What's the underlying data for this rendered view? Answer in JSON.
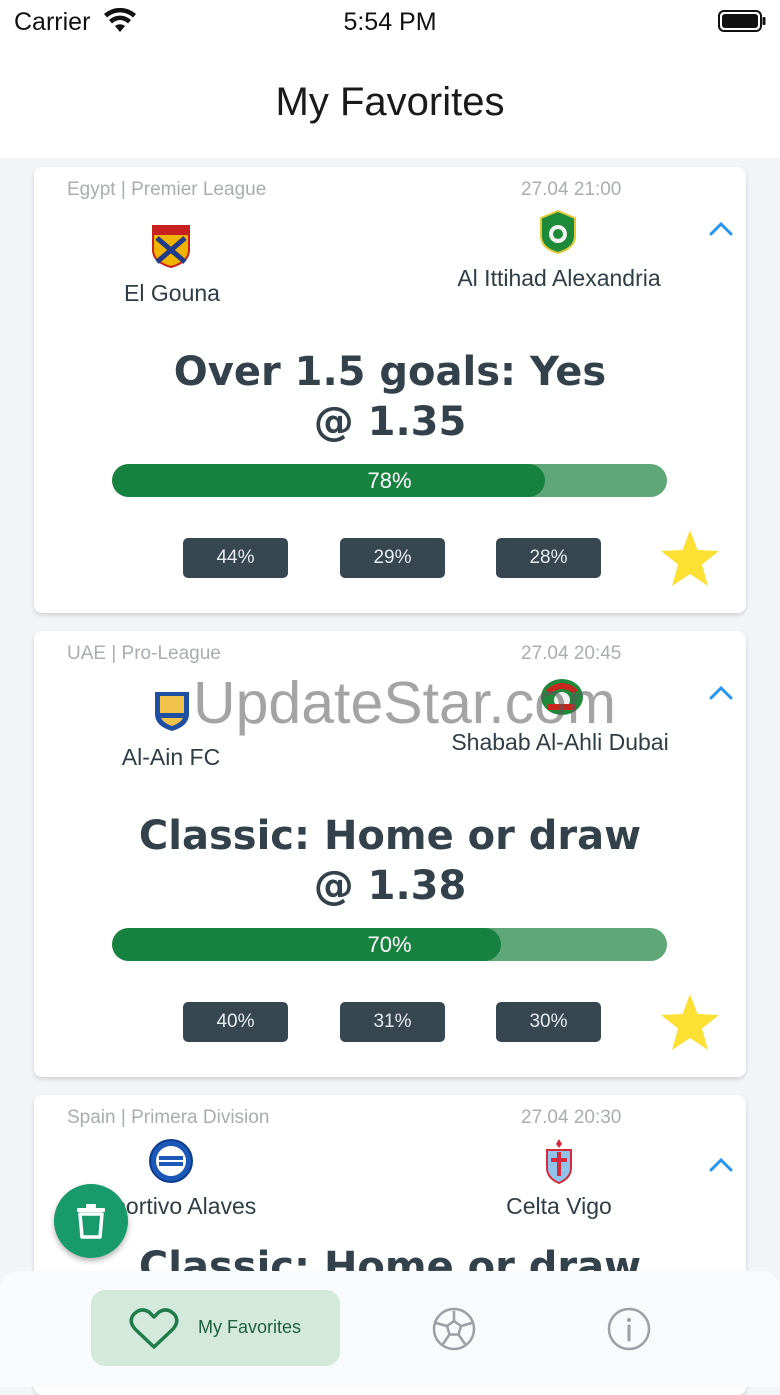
{
  "status_bar": {
    "carrier": "Carrier",
    "time": "5:54 PM"
  },
  "header": {
    "title": "My Favorites"
  },
  "matches": [
    {
      "league": "Egypt | Premier League",
      "date": "27.04 21:00",
      "home": {
        "name": "El Gouna"
      },
      "away": {
        "name": "Al Ittihad Alexandria"
      },
      "tip_line1": "Over 1.5 goals: Yes",
      "tip_line2": "@ 1.35",
      "confidence": 78,
      "confidence_label": "78%",
      "odds": [
        "44%",
        "29%",
        "28%"
      ],
      "favorite": true
    },
    {
      "league": "UAE | Pro-League",
      "date": "27.04 20:45",
      "home": {
        "name": "Al-Ain FC"
      },
      "away": {
        "name": "Shabab Al-Ahli Dubai"
      },
      "tip_line1": "Classic: Home or draw",
      "tip_line2": "@ 1.38",
      "confidence": 70,
      "confidence_label": "70%",
      "odds": [
        "40%",
        "31%",
        "30%"
      ],
      "favorite": true
    },
    {
      "league": "Spain | Primera Division",
      "date": "27.04 20:30",
      "home": {
        "name": "Deportivo Alaves"
      },
      "away": {
        "name": "Celta Vigo"
      },
      "tip_line1": "Classic: Home or draw"
    }
  ],
  "tabs": [
    {
      "label": "My Favorites",
      "icon": "heart-icon",
      "active": true
    },
    {
      "label": "",
      "icon": "soccer-ball-icon",
      "active": false
    },
    {
      "label": "",
      "icon": "info-icon",
      "active": false
    }
  ],
  "fab": {
    "icon": "trash-icon"
  },
  "watermark": "UpdateStar.com",
  "colors": {
    "bar_fill": "#17813f",
    "bar_track": "#5fa777",
    "pill_bg": "#37474f",
    "star": "#fce033",
    "fab": "#189a6c",
    "tab_active_bg": "#d3e9dc",
    "chevron": "#2196f3"
  }
}
